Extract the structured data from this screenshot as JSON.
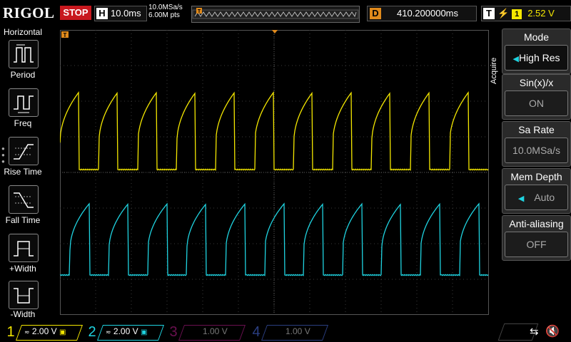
{
  "top": {
    "brand": "RIGOL",
    "run_state": "STOP",
    "horizontal_prefix": "H",
    "timebase": "10.0ms",
    "sample_rate": "10.0MSa/s",
    "memory_points": "6.00M pts",
    "delay_prefix": "D",
    "delay": "410.200000ms",
    "trigger_prefix": "T",
    "trigger_source": "1",
    "trigger_level": "2.52 V"
  },
  "left_panel": {
    "title": "Horizontal",
    "items": [
      "Period",
      "Freq",
      "Rise Time",
      "Fall Time",
      "+Width",
      "-Width"
    ]
  },
  "right_menu": {
    "section": "Acquire",
    "items": [
      {
        "title": "Mode",
        "value": "High Res",
        "active": true
      },
      {
        "title": "Sin(x)/x",
        "value": "ON",
        "active": false
      },
      {
        "title": "Sa Rate",
        "value": "10.0MSa/s",
        "active": false
      },
      {
        "title": "Mem Depth",
        "value": "Auto",
        "active": false
      },
      {
        "title": "Anti-aliasing",
        "value": "OFF",
        "active": false
      }
    ]
  },
  "channels": [
    {
      "num": "1",
      "scale": "2.00 V",
      "color": "#f5e800",
      "enabled": true
    },
    {
      "num": "2",
      "scale": "2.00 V",
      "color": "#1fd3e0",
      "enabled": true
    },
    {
      "num": "3",
      "scale": "1.00 V",
      "color": "#c01e9a",
      "enabled": false
    },
    {
      "num": "4",
      "scale": "1.00 V",
      "color": "#3a66d8",
      "enabled": false
    }
  ],
  "markers": {
    "ch1": "1",
    "ch2": "2",
    "trig_top": "T",
    "trig_level": "T"
  },
  "colors": {
    "ch1": "#f5e800",
    "ch2": "#1fd3e0",
    "accent": "#e08a1c",
    "stop": "#c8181e"
  }
}
